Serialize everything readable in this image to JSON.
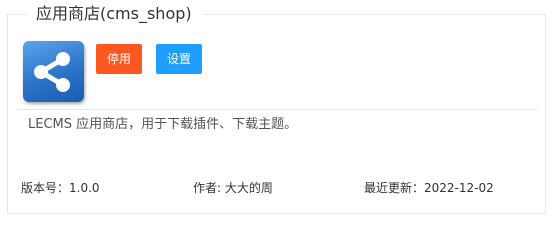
{
  "plugin": {
    "title": "应用商店(cms_shop)",
    "icon": "share-icon",
    "description": "LECMS 应用商店，用于下载插件、下载主题。"
  },
  "actions": {
    "disable_label": "停用",
    "settings_label": "设置"
  },
  "meta": {
    "version": "版本号：1.0.0",
    "author": "作者: 大大的周",
    "updated": "最近更新：2022-12-02"
  },
  "colors": {
    "disable_button": "#ff5722",
    "settings_button": "#1e9fff",
    "icon_background": "#2c74c9",
    "border": "#e6e6e6"
  }
}
